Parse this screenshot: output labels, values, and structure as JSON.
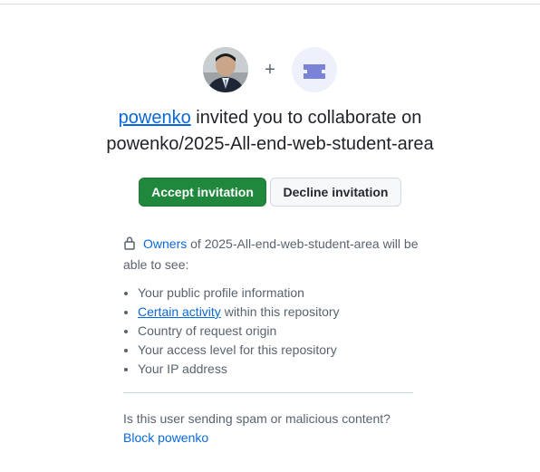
{
  "inviter": {
    "name": "powenko",
    "avatar_icon": "user-photo"
  },
  "plus_symbol": "+",
  "repo_icon": "repo-logo-icon",
  "title": {
    "middle": " invited you to collaborate on",
    "repo": "powenko/2025-All-end-web-student-area"
  },
  "buttons": {
    "accept": "Accept invitation",
    "decline": "Decline invitation"
  },
  "visibility": {
    "owners_link": "Owners",
    "rest": " of 2025-All-end-web-student-area will be able to see:",
    "items": [
      {
        "text": "Your public profile information"
      },
      {
        "link": "Certain activity",
        "text": " within this repository"
      },
      {
        "text": "Country of request origin"
      },
      {
        "text": "Your access level for this repository"
      },
      {
        "text": "Your IP address"
      }
    ]
  },
  "spam": {
    "question": "Is this user sending spam or malicious content?",
    "block_link": "Block powenko"
  },
  "colors": {
    "accent": "#0969da",
    "accept": "#1f883d",
    "repo_logo": "#7b83d6"
  }
}
